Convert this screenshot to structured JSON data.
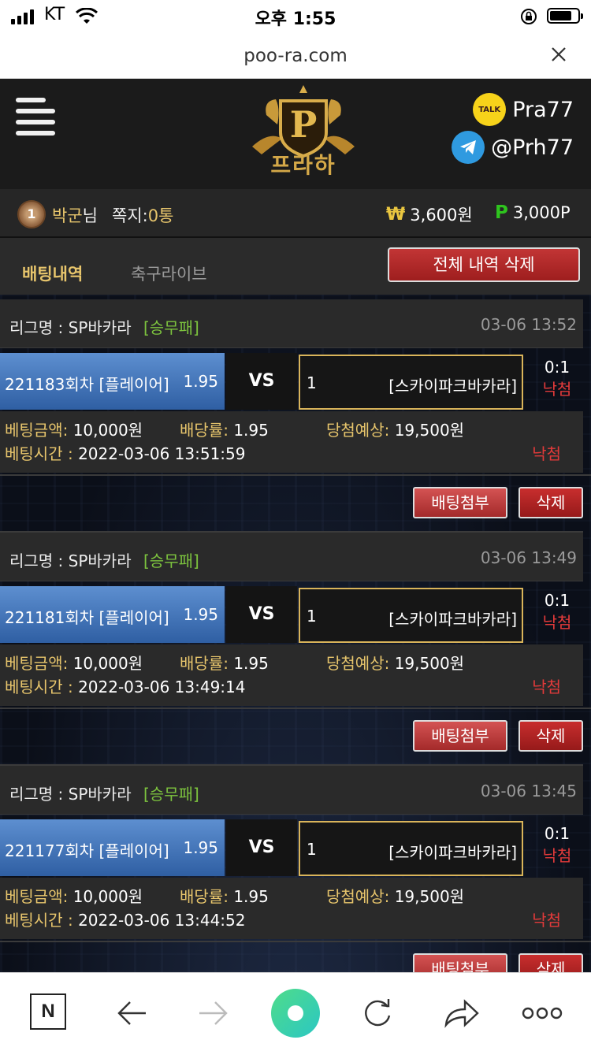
{
  "status_bar": {
    "carrier": "KT",
    "time": "오후 1:55"
  },
  "browser": {
    "url": "poo-ra.com"
  },
  "header": {
    "brand": "프라하",
    "kakao_id": "Pra77",
    "kakao_badge": "TALK",
    "telegram_id": "@Prh77"
  },
  "user": {
    "level": "1",
    "name": "박군",
    "suffix": "님",
    "messages_label": "쪽지:",
    "messages_count": "0통",
    "money_symbol": "₩",
    "money": "3,600원",
    "point_symbol": "P",
    "points": "3,000P"
  },
  "tabs": [
    {
      "label": "배팅내역",
      "active": true
    },
    {
      "label": "축구라이브",
      "active": false
    }
  ],
  "delete_all_label": "전체 내역 삭제",
  "labels": {
    "league": "리그명 : ",
    "vs": "VS",
    "bet_amount": "베팅금액:",
    "dividend": "배당률:",
    "expected": "당첨예상:",
    "bet_time": "베팅시간 : ",
    "attach": "배팅첨부",
    "delete": "삭제"
  },
  "bets": [
    {
      "league": "SP바카라",
      "bet_type": "[승무패]",
      "datetime": "03-06 13:52",
      "pick_name": "221183회차 [플레이어]",
      "pick_odds": "1.95",
      "opp_num": "1",
      "opp_name": "[스카이파크바카라]",
      "score": "0:1",
      "result": "낙첨",
      "amount": "10,000원",
      "rate": "1.95",
      "expected": "19,500원",
      "time": "2022-03-06 13:51:59",
      "status": "낙첨"
    },
    {
      "league": "SP바카라",
      "bet_type": "[승무패]",
      "datetime": "03-06 13:49",
      "pick_name": "221181회차 [플레이어]",
      "pick_odds": "1.95",
      "opp_num": "1",
      "opp_name": "[스카이파크바카라]",
      "score": "0:1",
      "result": "낙첨",
      "amount": "10,000원",
      "rate": "1.95",
      "expected": "19,500원",
      "time": "2022-03-06 13:49:14",
      "status": "낙첨"
    },
    {
      "league": "SP바카라",
      "bet_type": "[승무패]",
      "datetime": "03-06 13:45",
      "pick_name": "221177회차 [플레이어]",
      "pick_odds": "1.95",
      "opp_num": "1",
      "opp_name": "[스카이파크바카라]",
      "score": "0:1",
      "result": "낙첨",
      "amount": "10,000원",
      "rate": "1.95",
      "expected": "19,500원",
      "time": "2022-03-06 13:44:52",
      "status": "낙첨"
    }
  ],
  "colors": {
    "accent_gold": "#e7c56c",
    "lose_red": "#e23a3a",
    "pick_blue": "#3f74bf",
    "type_green": "#7dc43e"
  },
  "toolbar_icons": [
    "naver-n-icon",
    "back-arrow-icon",
    "forward-arrow-icon",
    "home-green-icon",
    "reload-icon",
    "share-icon",
    "more-icon"
  ]
}
